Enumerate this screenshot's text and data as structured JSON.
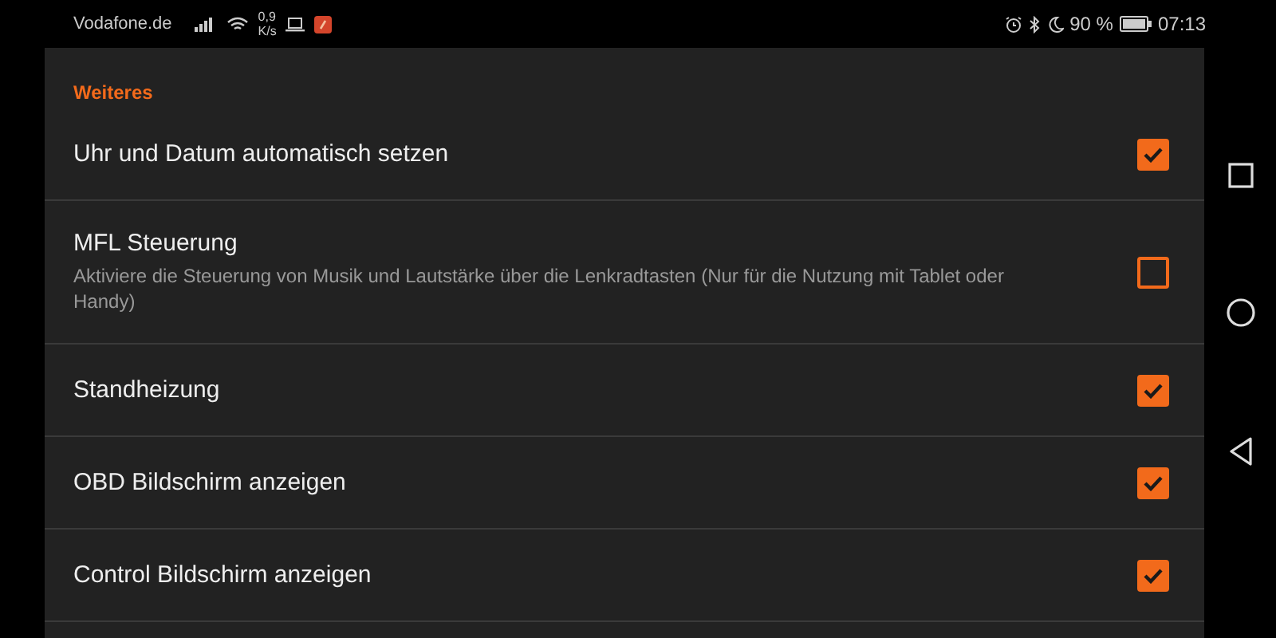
{
  "status_bar": {
    "carrier": "Vodafone.de",
    "speed_value": "0,9",
    "speed_unit": "K/s",
    "battery_percent": "90 %",
    "time": "07:13"
  },
  "section": {
    "title": "Weiteres"
  },
  "settings": [
    {
      "title": "Uhr und Datum automatisch setzen",
      "checked": true
    },
    {
      "title": "MFL Steuerung",
      "summary": "Aktiviere die Steuerung von Musik und Lautstärke über die Lenkradtasten (Nur für die Nutzung mit Tablet oder Handy)",
      "checked": false
    },
    {
      "title": "Standheizung",
      "checked": true
    },
    {
      "title": "OBD Bildschirm anzeigen",
      "checked": true
    },
    {
      "title": "Control Bildschirm anzeigen",
      "checked": true
    }
  ]
}
